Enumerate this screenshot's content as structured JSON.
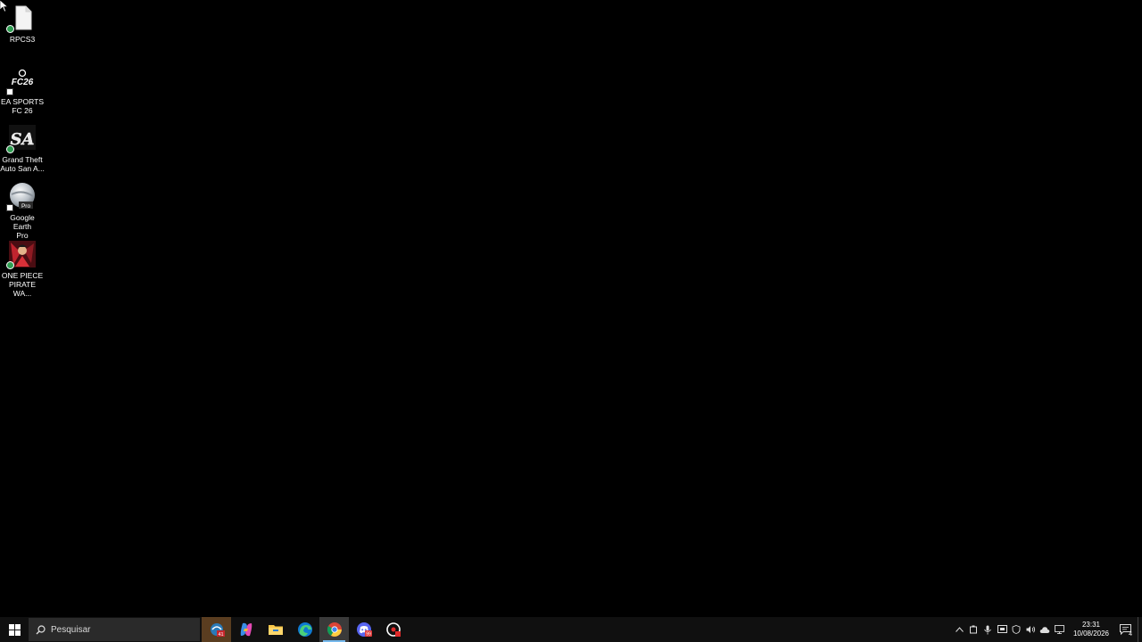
{
  "desktop": {
    "icons": [
      {
        "label": "RPCS3",
        "icon": "file-icon"
      },
      {
        "label": "EA SPORTS\nFC 26",
        "icon": "fc26-icon",
        "badge_text": "FC26"
      },
      {
        "label": "Grand Theft\nAuto San A...",
        "icon": "gta-sa-icon",
        "badge_text": "SA"
      },
      {
        "label": "Google Earth\nPro",
        "icon": "google-earth-icon",
        "badge_text": "Pro"
      },
      {
        "label": "ONE PIECE\nPIRATE WA...",
        "icon": "one-piece-icon"
      }
    ]
  },
  "taskbar": {
    "search_placeholder": "Pesquisar",
    "apps": [
      {
        "name": "app-orange-icon",
        "badge": "41"
      },
      {
        "name": "copilot-icon"
      },
      {
        "name": "file-explorer-icon"
      },
      {
        "name": "edge-icon"
      },
      {
        "name": "chrome-icon"
      },
      {
        "name": "discord-icon",
        "badge": "99"
      },
      {
        "name": "recorder-icon"
      }
    ],
    "tray": {
      "time": "23:31",
      "date": "10/08/2026",
      "notification_count": "4"
    }
  },
  "colors": {
    "desktop_bg": "#000000",
    "taskbar_bg": "#101010",
    "accent": "#76b9ed"
  }
}
